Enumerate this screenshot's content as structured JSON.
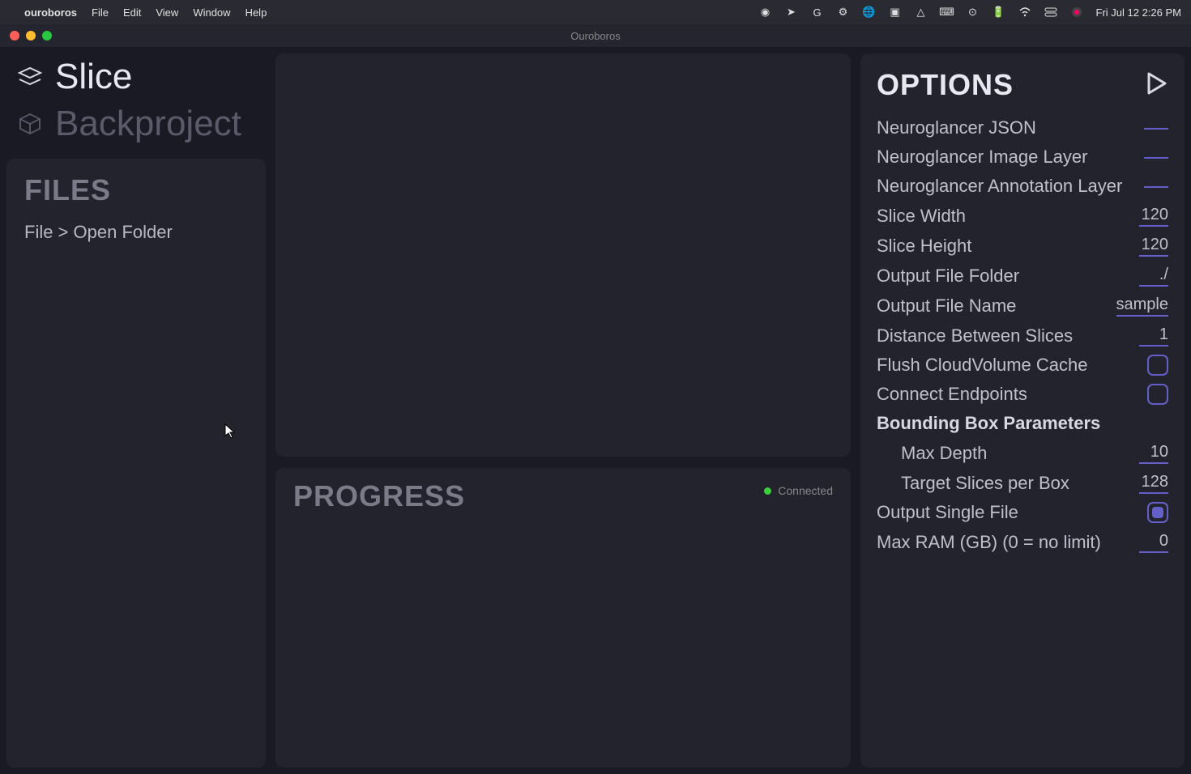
{
  "menubar": {
    "app_name": "ouroboros",
    "items": [
      "File",
      "Edit",
      "View",
      "Window",
      "Help"
    ],
    "date_time": "Fri Jul 12  2:26 PM"
  },
  "window": {
    "title": "Ouroboros"
  },
  "sidebar": {
    "nav": [
      {
        "label": "Slice",
        "active": true
      },
      {
        "label": "Backproject",
        "active": false
      }
    ],
    "files": {
      "title": "FILES",
      "hint": "File > Open Folder"
    }
  },
  "progress": {
    "title": "PROGRESS",
    "status_label": "Connected"
  },
  "options": {
    "title": "OPTIONS",
    "rows": [
      {
        "label": "Neuroglancer JSON",
        "type": "text",
        "value": ""
      },
      {
        "label": "Neuroglancer Image Layer",
        "type": "text",
        "value": ""
      },
      {
        "label": "Neuroglancer Annotation Layer",
        "type": "text",
        "value": ""
      },
      {
        "label": "Slice Width",
        "type": "text",
        "value": "120"
      },
      {
        "label": "Slice Height",
        "type": "text",
        "value": "120"
      },
      {
        "label": "Output File Folder",
        "type": "text",
        "value": "./"
      },
      {
        "label": "Output File Name",
        "type": "text",
        "value": "sample"
      },
      {
        "label": "Distance Between Slices",
        "type": "text",
        "value": "1"
      },
      {
        "label": "Flush CloudVolume Cache",
        "type": "checkbox",
        "checked": false
      },
      {
        "label": "Connect Endpoints",
        "type": "checkbox",
        "checked": false
      },
      {
        "label": "Bounding Box Parameters",
        "type": "header"
      },
      {
        "label": "Max Depth",
        "type": "text",
        "value": "10",
        "sub": true
      },
      {
        "label": "Target Slices per Box",
        "type": "text",
        "value": "128",
        "sub": true
      },
      {
        "label": "Output Single File",
        "type": "checkbox",
        "checked": true
      },
      {
        "label": "Max RAM (GB) (0 = no limit)",
        "type": "text",
        "value": "0"
      }
    ]
  }
}
